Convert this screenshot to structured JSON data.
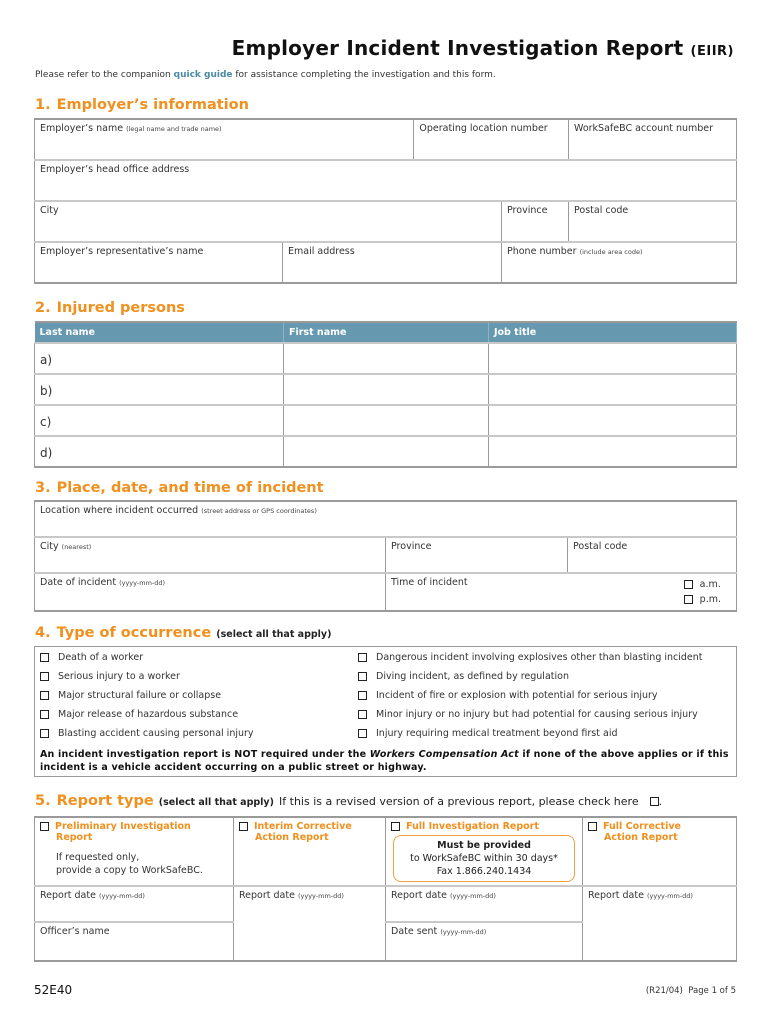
{
  "header": {
    "title": "Employer Incident Investigation Report",
    "title_abbr": "(EIIR)",
    "intro_before": "Please refer to the companion ",
    "intro_link": "quick guide",
    "intro_after": " for assistance completing the investigation and this form."
  },
  "section1": {
    "number": "1.",
    "title": "Employer’s information",
    "employer_name": "Employer’s name",
    "employer_name_note": "(legal name and trade name)",
    "operating_location": "Operating location number",
    "account_number": "WorkSafeBC account number",
    "head_office": "Employer’s head office address",
    "city": "City",
    "province": "Province",
    "postal_code": "Postal code",
    "rep_name": "Employer’s representative’s name",
    "email": "Email address",
    "phone": "Phone number",
    "phone_note": "(include area code)"
  },
  "section2": {
    "number": "2.",
    "title": "Injured persons",
    "columns": [
      "Last name",
      "First name",
      "Job title"
    ],
    "rows": [
      "a)",
      "b)",
      "c)",
      "d)"
    ]
  },
  "section3": {
    "number": "3.",
    "title": "Place, date, and time of incident",
    "location": "Location where incident occurred",
    "location_note": "(street address or GPS coordinates)",
    "city": "City",
    "city_note": "(nearest)",
    "province": "Province",
    "postal_code": "Postal code",
    "date": "Date of incident",
    "date_note": "(yyyy-mm-dd)",
    "time": "Time of incident",
    "am": "a.m.",
    "pm": "p.m."
  },
  "section4": {
    "number": "4.",
    "title": "Type of occurrence",
    "note": "(select all that apply)",
    "left_items": [
      "Death of a worker",
      "Serious injury to a worker",
      "Major structural failure or collapse",
      "Major release of hazardous substance",
      "Blasting accident causing personal injury"
    ],
    "right_items": [
      "Dangerous incident involving explosives other than blasting incident",
      "Diving incident, as defined by regulation",
      "Incident of fire or explosion with potential for serious injury",
      "Minor injury or no injury but had potential for causing serious injury",
      "Injury requiring medical treatment beyond first aid"
    ],
    "warning_before": "An incident investigation report is NOT required under the ",
    "warning_act": "Workers Compensation Act",
    "warning_after": " if none of the above applies or if this incident is a vehicle accident occurring on a public street or highway."
  },
  "section5": {
    "number": "5.",
    "title": "Report type",
    "note": "(select all that apply)",
    "revised_text": "If this is a revised version of a previous report, please check here",
    "types": [
      {
        "line1": "Preliminary Investigation",
        "line2": "Report"
      },
      {
        "line1": "Interim Corrective",
        "line2": "Action Report"
      },
      {
        "line1": "Full Investigation Report",
        "line2": ""
      },
      {
        "line1": "Full Corrective",
        "line2": "Action Report"
      }
    ],
    "preliminary_note1": "If requested only,",
    "preliminary_note2": "provide a copy to WorkSafeBC.",
    "must_title": "Must be provided",
    "must_line2": "to WorkSafeBC within 30 days*",
    "must_fax": "Fax 1.866.240.1434",
    "report_date": "Report date",
    "date_note": "(yyyy-mm-dd)",
    "officer_name": "Officer’s name",
    "date_sent": "Date sent"
  },
  "footer": {
    "form_code": "52E40",
    "revision": "(R21/04)",
    "page": "Page 1 of 5"
  }
}
